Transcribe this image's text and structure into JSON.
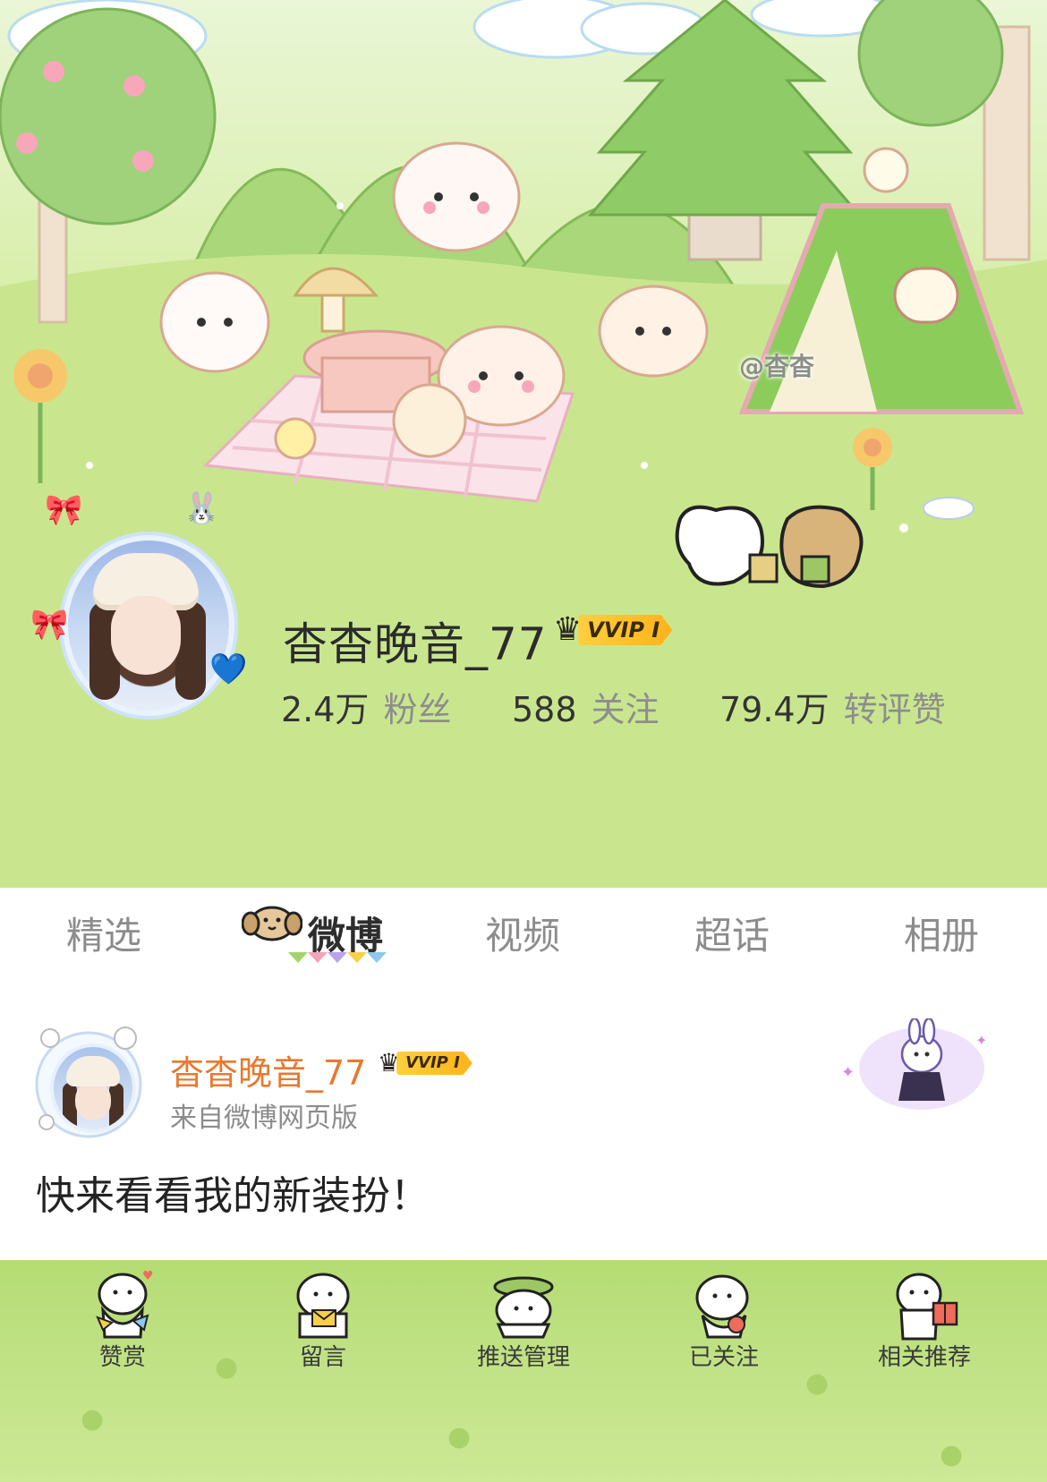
{
  "cover": {
    "watermark": "@杳杳"
  },
  "profile": {
    "name": "杳杳晚音_77",
    "vip_badge": "VVIP I",
    "stats": [
      {
        "value": "2.4万",
        "label": "粉丝"
      },
      {
        "value": "588",
        "label": "关注"
      },
      {
        "value": "79.4万",
        "label": "转评赞"
      }
    ]
  },
  "tabs": [
    {
      "label": "精选",
      "active": false
    },
    {
      "label": "微博",
      "active": true
    },
    {
      "label": "视频",
      "active": false
    },
    {
      "label": "超话",
      "active": false
    },
    {
      "label": "相册",
      "active": false
    }
  ],
  "post": {
    "author": "杳杳晚音_77",
    "vip_badge": "VVIP I",
    "source": "来自微博网页版",
    "text": "快来看看我的新装扮！"
  },
  "actions": [
    {
      "label": "赞赏",
      "icon": "puppy-gift-icon"
    },
    {
      "label": "留言",
      "icon": "puppy-letter-icon"
    },
    {
      "label": "推送管理",
      "icon": "puppy-leaf-icon"
    },
    {
      "label": "已关注",
      "icon": "puppy-heart-icon"
    },
    {
      "label": "相关推荐",
      "icon": "puppy-box-icon"
    }
  ],
  "colors": {
    "accent_name": "#e8792f",
    "vip_gold": "#ffc12a",
    "theme_green": "#bfe183"
  }
}
